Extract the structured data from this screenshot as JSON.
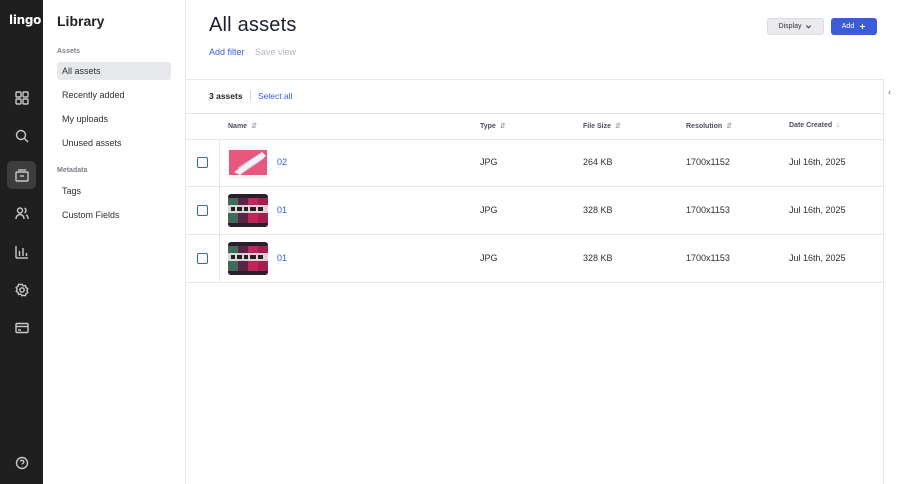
{
  "app": {
    "logo": "lingo"
  },
  "rail": {
    "items": [
      {
        "icon": "dashboard-icon"
      },
      {
        "icon": "search-icon"
      },
      {
        "icon": "library-icon",
        "active": true
      },
      {
        "icon": "users-icon"
      },
      {
        "icon": "analytics-icon"
      },
      {
        "icon": "settings-icon"
      },
      {
        "icon": "billing-icon"
      }
    ],
    "bottom": {
      "icon": "help-icon"
    }
  },
  "library": {
    "title": "Library",
    "sections": [
      {
        "label": "Assets",
        "items": [
          "All assets",
          "Recently added",
          "My uploads",
          "Unused assets"
        ]
      },
      {
        "label": "Metadata",
        "items": [
          "Tags",
          "Custom Fields"
        ]
      }
    ]
  },
  "main": {
    "title": "All assets",
    "display_label": "Display",
    "add_label": "Add",
    "add_filter": "Add filter",
    "save_view": "Save view",
    "count": "3 assets",
    "select_all": "Select all"
  },
  "table": {
    "columns": [
      "Name",
      "Type",
      "File Size",
      "Resolution",
      "Date Created"
    ],
    "rows": [
      {
        "name": "02",
        "type": "JPG",
        "size": "264 KB",
        "resolution": "1700x1152",
        "date": "Jul 16th, 2025"
      },
      {
        "name": "01",
        "type": "JPG",
        "size": "328 KB",
        "resolution": "1700x1153",
        "date": "Jul 16th, 2025"
      },
      {
        "name": "01",
        "type": "JPG",
        "size": "328 KB",
        "resolution": "1700x1153",
        "date": "Jul 16th, 2025"
      }
    ]
  },
  "colors": {
    "accent": "#3b5bdb",
    "rail": "#1f1f1f"
  }
}
